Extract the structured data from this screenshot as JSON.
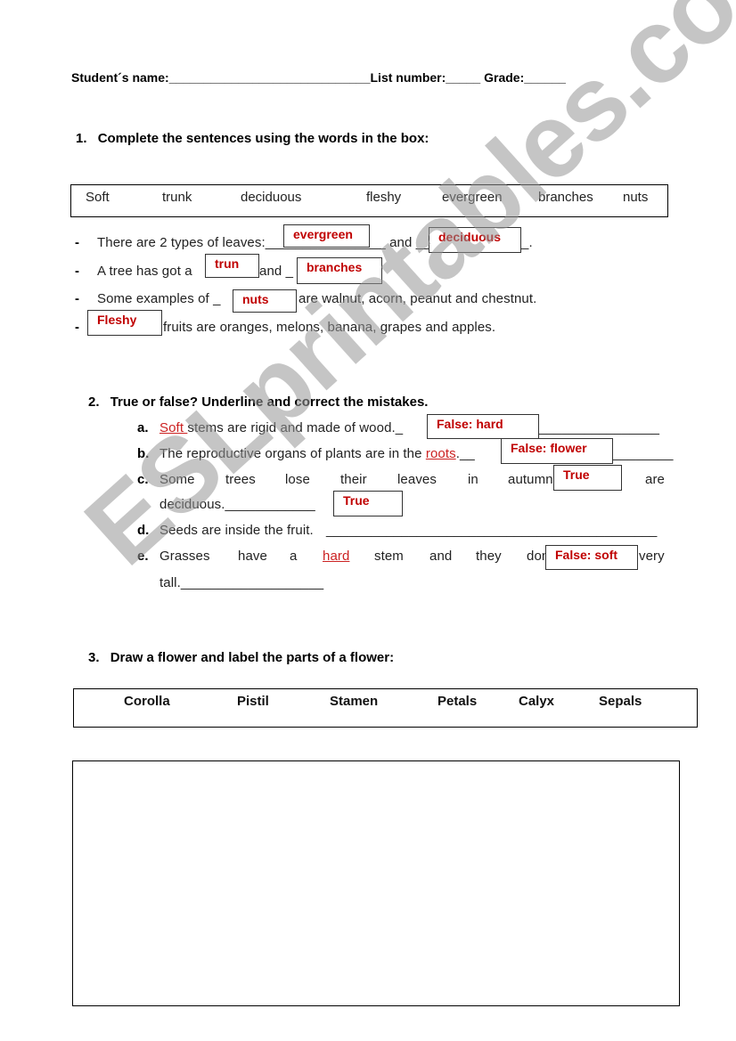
{
  "header": {
    "student_name_label": "Student´s name:",
    "student_name_blank": "_____________________________",
    "list_number_label": "List number:",
    "list_number_blank": "_____",
    "grade_label": "Grade:",
    "grade_blank": "______"
  },
  "section1": {
    "number": "1.",
    "title": "Complete the sentences using the words in the box:",
    "word_box": [
      "Soft",
      "trunk",
      "deciduous",
      "fleshy",
      "evergreen",
      "branches",
      "nuts"
    ],
    "sentences": [
      {
        "bullet": "-",
        "parts": [
          "There are 2 types of leaves:",
          "_",
          "_ and _",
          "_."
        ],
        "answers": [
          "evergreen",
          "deciduous"
        ]
      },
      {
        "bullet": "-",
        "parts": [
          "A tree has got a ",
          "and _"
        ],
        "answers": [
          "trun",
          "branches"
        ]
      },
      {
        "bullet": "-",
        "parts": [
          "Some examples of _",
          "are walnut, acorn, peanut and chestnut."
        ],
        "answers": [
          "nuts"
        ]
      },
      {
        "bullet": "-",
        "parts": [
          "fruits are oranges, melons, banana, grapes and apples."
        ],
        "answers": [
          "Fleshy"
        ]
      }
    ]
  },
  "section2": {
    "number": "2.",
    "title": "True or false? Underline and correct the mistakes.",
    "items": [
      {
        "letter": "a.",
        "underlined": "Soft ",
        "text": "stems are rigid and made of wood._",
        "trail": "________________",
        "answer": "False: hard"
      },
      {
        "letter": "b.",
        "pre": "The reproductive organs of plants are in the ",
        "underlined": "roots",
        "post": ".__",
        "trail": "________",
        "answer": "False: flower"
      },
      {
        "letter": "c.",
        "words": [
          "Some",
          "trees",
          "lose",
          "their",
          "leaves",
          "in",
          "autumn",
          "are"
        ],
        "line2": "deciduous.____________",
        "answers": [
          "True",
          "True"
        ]
      },
      {
        "letter": "d.",
        "text": "Seeds are inside the fruit.",
        "trail": "____________________________________________"
      },
      {
        "letter": "e.",
        "words": [
          "Grasses",
          "have",
          "a",
          "hard",
          "stem",
          "and",
          "they",
          "don",
          "very"
        ],
        "underlined_word": "hard",
        "line2": "tall.___________________",
        "answer": "False: soft"
      }
    ]
  },
  "section3": {
    "number": "3.",
    "title": "Draw a flower and label the parts of a flower:",
    "parts": [
      "Corolla",
      "Pistil",
      "Stamen",
      "Petals",
      "Calyx",
      "Sepals"
    ]
  },
  "watermark": "ESLprintables.com",
  "colors": {
    "answer_red": "#c00000",
    "underline_red": "#cc2222"
  }
}
